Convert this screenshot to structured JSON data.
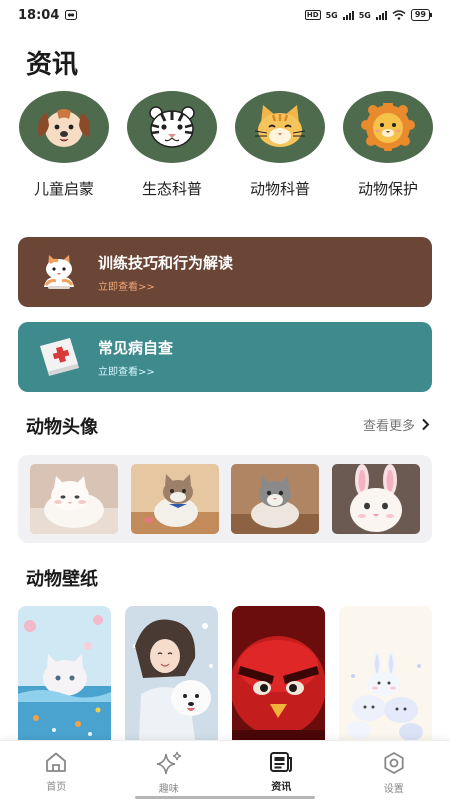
{
  "status_bar": {
    "time": "18:04",
    "network_badge": "HD",
    "signal_1": "5G",
    "signal_2": "5G",
    "battery": "99"
  },
  "page": {
    "title": "资讯"
  },
  "categories": [
    {
      "label": "儿童启蒙",
      "icon": "puppy-icon"
    },
    {
      "label": "生态科普",
      "icon": "tiger-icon"
    },
    {
      "label": "动物科普",
      "icon": "cat-icon"
    },
    {
      "label": "动物保护",
      "icon": "lion-icon"
    }
  ],
  "banners": [
    {
      "title": "训练技巧和行为解读",
      "link": "立即查看>>",
      "color": "#6b4535",
      "icon": "cat-illustration"
    },
    {
      "title": "常见病自查",
      "link": "立即查看>>",
      "color": "#3e8a8c",
      "icon": "medical-book-icon"
    }
  ],
  "avatars": {
    "title": "动物头像",
    "more_label": "查看更多",
    "items": [
      "white-cat-photo",
      "tabby-cat-photo",
      "grey-cat-photo",
      "bunny-ears-cat-photo"
    ]
  },
  "wallpapers": {
    "title": "动物壁纸",
    "items": [
      "water-cat-wallpaper",
      "girl-dog-wallpaper",
      "angry-bird-wallpaper",
      "bunnies-wallpaper"
    ]
  },
  "tabbar": {
    "active": "资讯",
    "items": [
      {
        "label": "首页",
        "icon": "home-icon"
      },
      {
        "label": "趣味",
        "icon": "sparkle-icon"
      },
      {
        "label": "资讯",
        "icon": "news-icon"
      },
      {
        "label": "设置",
        "icon": "settings-icon"
      }
    ]
  },
  "colors": {
    "category_bg": "#4f6b4e",
    "banner_brown": "#6b4535",
    "banner_teal": "#3e8a8c",
    "link_orange": "#f0a878"
  }
}
